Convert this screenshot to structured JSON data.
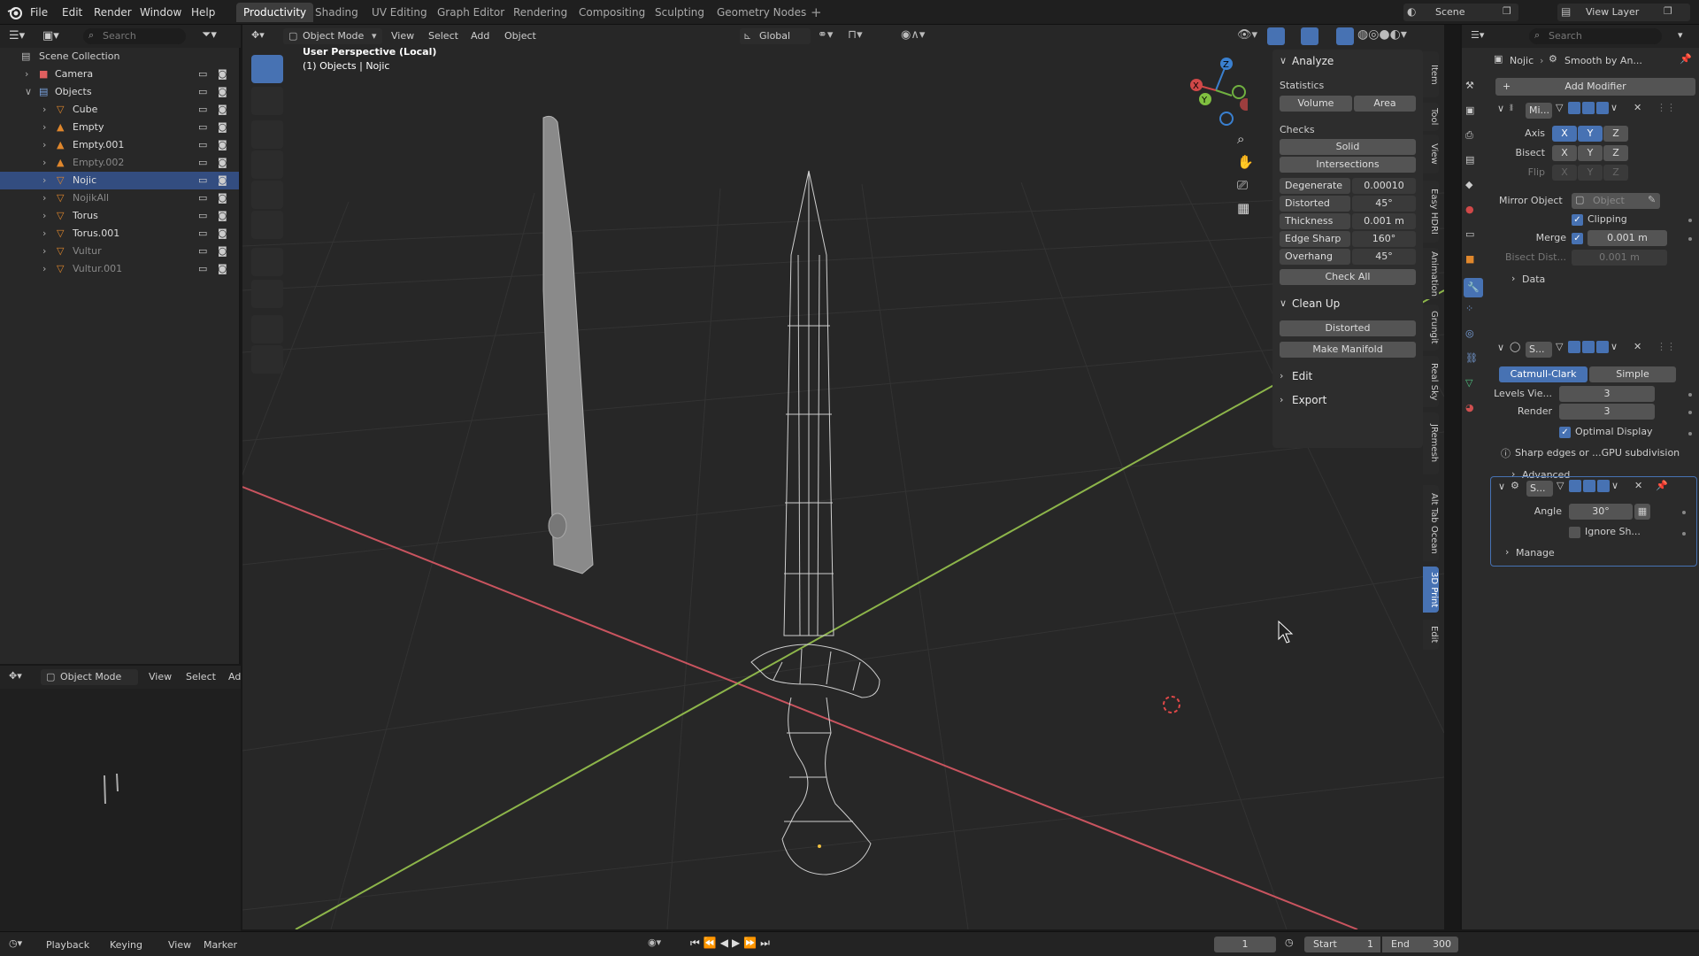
{
  "menus": [
    "File",
    "Edit",
    "Render",
    "Window",
    "Help"
  ],
  "workspaces": [
    "Productivity",
    "Shading",
    "UV Editing",
    "Graph Editor",
    "Rendering",
    "Compositing",
    "Sculpting",
    "Geometry Nodes"
  ],
  "scene": {
    "name": "Scene",
    "view_layer": "View Layer"
  },
  "outliner": {
    "search_placeholder": "Search",
    "root": "Scene Collection",
    "items": [
      {
        "name": "Camera",
        "indent": 1
      },
      {
        "name": "Objects",
        "indent": 1
      },
      {
        "name": "Cube",
        "indent": 2
      },
      {
        "name": "Empty",
        "indent": 2
      },
      {
        "name": "Empty.001",
        "indent": 2
      },
      {
        "name": "Empty.002",
        "indent": 2
      },
      {
        "name": "Nojic",
        "indent": 2
      },
      {
        "name": "NojikAll",
        "indent": 2
      },
      {
        "name": "Torus",
        "indent": 2
      },
      {
        "name": "Torus.001",
        "indent": 2
      },
      {
        "name": "Vultur",
        "indent": 2
      },
      {
        "name": "Vultur.001",
        "indent": 2
      }
    ]
  },
  "viewport": {
    "mode": "Object Mode",
    "menus": [
      "View",
      "Select",
      "Add",
      "Object"
    ],
    "orientation": "Global",
    "overlay_title": "User Perspective (Local)",
    "overlay_sub": "(1) Objects | Nojic"
  },
  "bottom_left": {
    "mode": "Object Mode",
    "menus": [
      "View",
      "Select",
      "Ad"
    ]
  },
  "print3d": {
    "analyze_title": "Analyze",
    "statistics": "Statistics",
    "volume": "Volume",
    "area": "Area",
    "checks": "Checks",
    "solid": "Solid",
    "intersections": "Intersections",
    "rows": [
      {
        "label": "Degenerate",
        "value": "0.00010"
      },
      {
        "label": "Distorted",
        "value": "45°"
      },
      {
        "label": "Thickness",
        "value": "0.001 m"
      },
      {
        "label": "Edge Sharp",
        "value": "160°"
      },
      {
        "label": "Overhang",
        "value": "45°"
      }
    ],
    "check_all": "Check All",
    "cleanup_title": "Clean Up",
    "distorted": "Distorted",
    "make_manifold": "Make Manifold",
    "edit": "Edit",
    "export": "Export"
  },
  "side_tabs": [
    "Item",
    "Tool",
    "View",
    "Easy HDRI",
    "Animation",
    "Grungit",
    "Real Sky",
    "JRemesh",
    "Alt Tab Ocean",
    "3D Print",
    "Edit"
  ],
  "properties": {
    "search_placeholder": "Search",
    "breadcrumb_obj": "Nojic",
    "breadcrumb_mod": "Smooth by An...",
    "add_modifier": "Add Modifier",
    "mirror": {
      "name": "Mi...",
      "axis_label": "Axis",
      "bisect_label": "Bisect",
      "flip_label": "Flip",
      "axes": [
        "X",
        "Y",
        "Z"
      ],
      "mirror_object_label": "Mirror Object",
      "mirror_object_placeholder": "Object",
      "clipping": "Clipping",
      "merge_label": "Merge",
      "merge_value": "0.001 m",
      "bisect_dist_label": "Bisect Dist...",
      "bisect_dist_value": "0.001 m",
      "data": "Data"
    },
    "subsurf": {
      "name": "S...",
      "catmull": "Catmull-Clark",
      "simple": "Simple",
      "levels_label": "Levels Vie...",
      "levels_value": "3",
      "render_label": "Render",
      "render_value": "3",
      "optimal": "Optimal Display",
      "info": "Sharp edges or ...GPU subdivision",
      "advanced": "Advanced"
    },
    "smooth": {
      "name": "S...",
      "angle_label": "Angle",
      "angle_value": "30°",
      "ignore": "Ignore Sh...",
      "manage": "Manage"
    }
  },
  "timeline": {
    "menus": [
      "Playback",
      "Keying",
      "View",
      "Marker"
    ],
    "current_frame": "1",
    "start_label": "Start",
    "start": "1",
    "end_label": "End",
    "end": "300"
  }
}
